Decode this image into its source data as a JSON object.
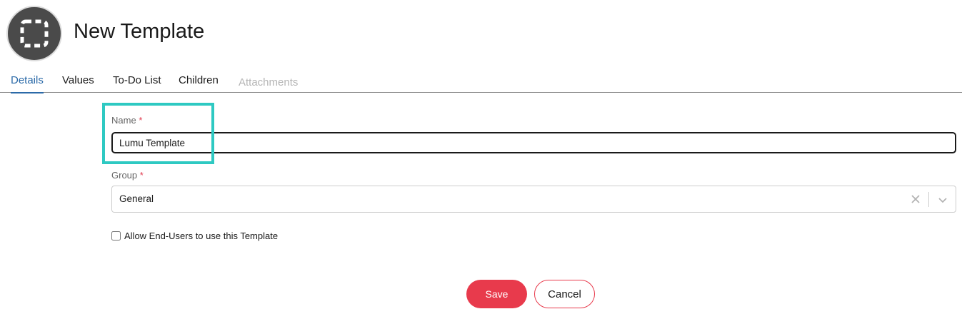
{
  "header": {
    "title": "New Template",
    "avatar_icon": "dashed-square-icon"
  },
  "tabs": [
    {
      "label": "Details",
      "active": true
    },
    {
      "label": "Values"
    },
    {
      "label": "To-Do List"
    },
    {
      "label": "Children"
    },
    {
      "label": "Attachments",
      "disabled": true
    }
  ],
  "form": {
    "name": {
      "label": "Name",
      "required_mark": "*",
      "value": "Lumu Template"
    },
    "group": {
      "label": "Group",
      "required_mark": "*",
      "value": "General"
    },
    "allow_end_users": {
      "label": "Allow End-Users to use this Template",
      "checked": false
    }
  },
  "actions": {
    "save_label": "Save",
    "cancel_label": "Cancel"
  },
  "colors": {
    "accent": "#2b6aa8",
    "primary_button": "#e83a4c",
    "highlight": "#2ec9c2"
  }
}
